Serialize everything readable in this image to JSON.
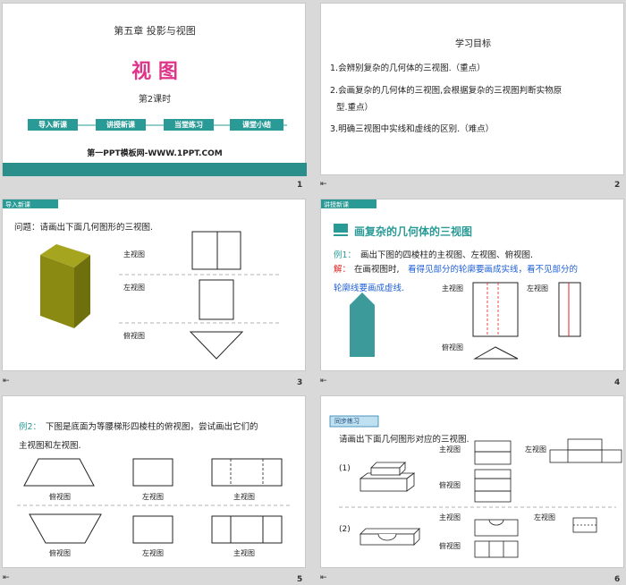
{
  "slide1": {
    "chapter": "第五章 投影与视图",
    "title": "视 图",
    "lesson": "第2课时",
    "steps": [
      "导入新课",
      "讲授新课",
      "当堂练习",
      "课堂小结"
    ],
    "website": "第一PPT模板网-WWW.1PPT.COM",
    "number": "1"
  },
  "slide2": {
    "heading": "学习目标",
    "items": [
      "1.会辨别复杂的几何体的三视图.（重点）",
      "2.会画复杂的几何体的三视图,会根据复杂的三视图判断实物原",
      "型.重点）",
      "3.明确三视图中实线和虚线的区别.（难点）"
    ],
    "number": "2"
  },
  "slide3": {
    "tag": "导入新课",
    "question": "问题：请画出下面几何图形的三视图.",
    "labels": [
      "主视图",
      "左视图",
      "俯视图"
    ],
    "number": "3"
  },
  "slide4": {
    "tag": "讲授新课",
    "heading": "画复杂的几何体的三视图",
    "example_label": "例1：",
    "example": "画出下图的四棱柱的主视图、左视图、俯视图.",
    "solution_label": "解：",
    "solution1_a": "在画视图时,",
    "solution1_b": "看得见部分的轮廓要画成实线，看不见部分的",
    "solution2": "轮廓线要画成虚线.",
    "labels": [
      "主视图",
      "左视图",
      "俯视图"
    ],
    "number": "4"
  },
  "slide5": {
    "line1_label": "例2：",
    "line1": "下图是底面为等腰梯形四棱柱的俯视图，尝试画出它们的",
    "line2": "主视图和左视图.",
    "labels_top": [
      "俯视图",
      "左视图",
      "主视图"
    ],
    "labels_bottom": [
      "俯视图",
      "左视图",
      "主视图"
    ],
    "number": "5"
  },
  "slide6": {
    "tag": "同步练习",
    "instruction": "请画出下面几何图形对应的三视图.",
    "item1": "(1)",
    "item2": "(2)",
    "labels1": [
      "主视图",
      "左视图",
      "俯视图"
    ],
    "labels2": [
      "主视图",
      "左视图",
      "俯视图"
    ],
    "number": "6"
  },
  "footer_icon": "skip-icon",
  "colors": {
    "teal": "#2a9a96",
    "magenta": "#e0338a",
    "blue": "#1f5fd6",
    "red": "#e02020",
    "olive": "#8a8a12"
  }
}
